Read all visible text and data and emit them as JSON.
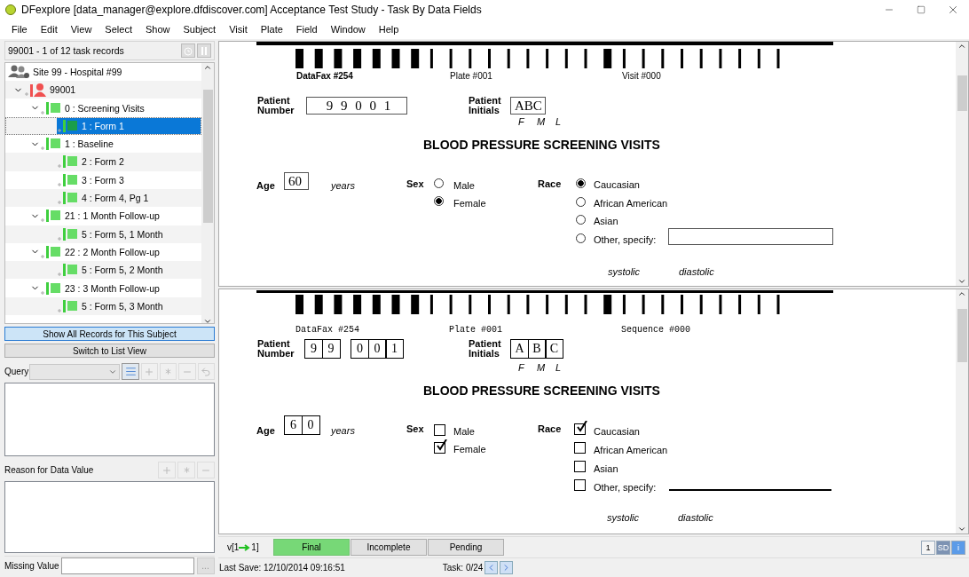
{
  "window": {
    "title": "DFexplore [data_manager@explore.dfdiscover.com] Acceptance Test Study - Task By Data Fields"
  },
  "menu": [
    "File",
    "Edit",
    "View",
    "Select",
    "Show",
    "Subject",
    "Visit",
    "Plate",
    "Field",
    "Window",
    "Help"
  ],
  "left_panel": {
    "record_count": "99001 - 1 of 12 task records",
    "tree": [
      {
        "kind": "site",
        "label": "Site 99 - Hospital #99",
        "children": [
          {
            "kind": "subject",
            "label": "99001",
            "expanded": true,
            "children": [
              {
                "kind": "visit",
                "label": "0 : Screening Visits",
                "expanded": true,
                "children": [
                  {
                    "kind": "form",
                    "label": "1 : Form 1",
                    "selected": true
                  }
                ]
              },
              {
                "kind": "visit",
                "label": "1 : Baseline",
                "expanded": true,
                "children": [
                  {
                    "kind": "form",
                    "label": "2 : Form 2",
                    "selected": false
                  },
                  {
                    "kind": "form",
                    "label": "3 : Form 3",
                    "selected": false
                  },
                  {
                    "kind": "form",
                    "label": "4 : Form 4, Pg 1",
                    "selected": false
                  }
                ]
              },
              {
                "kind": "visit",
                "label": "21 : 1 Month Follow-up",
                "expanded": true,
                "children": [
                  {
                    "kind": "form",
                    "label": "5 : Form 5, 1 Month",
                    "selected": false
                  }
                ]
              },
              {
                "kind": "visit",
                "label": "22 : 2 Month Follow-up",
                "expanded": true,
                "children": [
                  {
                    "kind": "form",
                    "label": "5 : Form 5, 2 Month",
                    "selected": false
                  }
                ]
              },
              {
                "kind": "visit",
                "label": "23 : 3 Month Follow-up",
                "expanded": true,
                "children": [
                  {
                    "kind": "form",
                    "label": "5 : Form 5, 3 Month",
                    "selected": false
                  }
                ]
              }
            ]
          }
        ]
      }
    ],
    "show_all_button": {
      "label": "Show All Records for This Subject",
      "on": true
    },
    "list_view_button": "Switch to List View",
    "query_label": "Query",
    "reason_label": "Reason for Data Value",
    "missing_value_label": "Missing Value",
    "missing_value_button": "..."
  },
  "form_view": {
    "barcode_labels": [
      "DataFax #254",
      "Plate #001",
      "Visit #000"
    ],
    "patient_number_label": "Patient Number",
    "patient_number": "9 9 0 0 1",
    "initials_label": "Patient Initials",
    "initials": "ABC",
    "initial_hints": [
      "F",
      "M",
      "L"
    ],
    "title": "BLOOD PRESSURE SCREENING VISITS",
    "age_label": "Age",
    "age": "60",
    "age_unit": "years",
    "sex_label": "Sex",
    "sex_options": [
      {
        "label": "Male",
        "selected": false
      },
      {
        "label": "Female",
        "selected": true
      }
    ],
    "race_label": "Race",
    "race_options": [
      {
        "label": "Caucasian",
        "selected": true
      },
      {
        "label": "African American",
        "selected": false
      },
      {
        "label": "Asian",
        "selected": false
      },
      {
        "label": "Other, specify:",
        "selected": false
      }
    ],
    "bp_labels": [
      "systolic",
      "diastolic"
    ]
  },
  "image_view": {
    "barcode_labels": [
      "DataFax #254",
      "Plate #001",
      "Sequence #000"
    ],
    "patient_number_label": "Patient Number",
    "patient_number_groups": [
      [
        "9",
        "9"
      ],
      [
        "0",
        "0",
        "1"
      ]
    ],
    "initials_label": "Patient Initials",
    "initials": [
      "A",
      "B",
      "C"
    ],
    "initial_hints": [
      "F",
      "M",
      "L"
    ],
    "title": "BLOOD PRESSURE SCREENING VISITS",
    "age_label": "Age",
    "age": [
      "6",
      "0"
    ],
    "age_unit": "years",
    "sex_label": "Sex",
    "sex_options": [
      {
        "label": "Male",
        "checked": false
      },
      {
        "label": "Female",
        "checked": true
      }
    ],
    "race_label": "Race",
    "race_options": [
      {
        "label": "Caucasian",
        "checked": true
      },
      {
        "label": "African American",
        "checked": false
      },
      {
        "label": "Asian",
        "checked": false
      },
      {
        "label": "Other, specify:",
        "checked": false
      }
    ],
    "bp_labels": [
      "systolic",
      "diastolic"
    ]
  },
  "status_row": {
    "version": [
      "v[1",
      "1]"
    ],
    "statuses": [
      {
        "label": "Final",
        "selected": true
      },
      {
        "label": "Incomplete",
        "selected": false
      },
      {
        "label": "Pending",
        "selected": false
      }
    ],
    "page": "1",
    "sd": "SD",
    "info": "i"
  },
  "status_bar": {
    "last_save": "Last Save: 12/10/2014 09:16:51",
    "task": "Task: 0/24"
  }
}
